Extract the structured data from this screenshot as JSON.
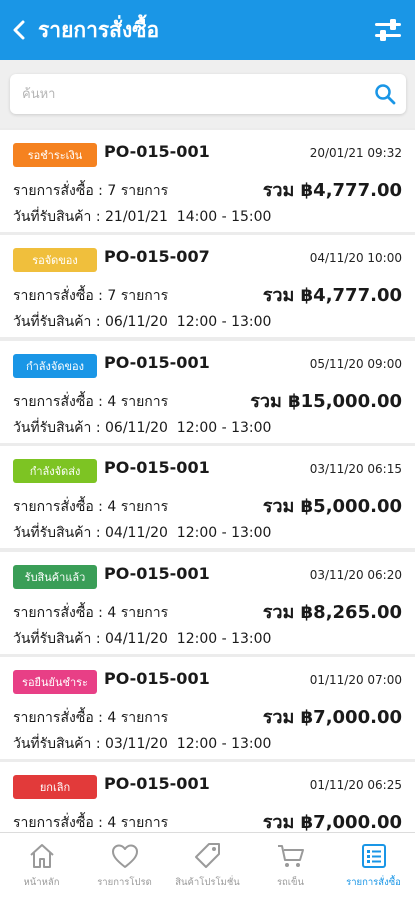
{
  "header": {
    "title": "รายการสั่งซื้อ"
  },
  "search": {
    "placeholder": "ค้นหา"
  },
  "orders": [
    {
      "status": "รอชำระเงิน",
      "color": "#f58220",
      "po": "PO-015-001",
      "date": "20/01/21 09:32",
      "items": "รายการสั่งซื้อ : 7 รายการ",
      "total": "รวม ฿4,777.00",
      "delivery": "วันที่รับสินค้า : 21/01/21  14:00 - 15:00"
    },
    {
      "status": "รอจัดของ",
      "color": "#f0bf3c",
      "po": "PO-015-007",
      "date": "04/11/20 10:00",
      "items": "รายการสั่งซื้อ : 7 รายการ",
      "total": "รวม ฿4,777.00",
      "delivery": "วันที่รับสินค้า : 06/11/20  12:00 - 13:00"
    },
    {
      "status": "กำลังจัดของ",
      "color": "#1a96e6",
      "po": "PO-015-001",
      "date": "05/11/20 09:00",
      "items": "รายการสั่งซื้อ : 4 รายการ",
      "total": "รวม ฿15,000.00",
      "delivery": "วันที่รับสินค้า : 06/11/20  12:00 - 13:00"
    },
    {
      "status": "กำลังจัดส่ง",
      "color": "#7dc423",
      "po": "PO-015-001",
      "date": "03/11/20 06:15",
      "items": "รายการสั่งซื้อ : 4 รายการ",
      "total": "รวม ฿5,000.00",
      "delivery": "วันที่รับสินค้า : 04/11/20  12:00 - 13:00"
    },
    {
      "status": "รับสินค้าแล้ว",
      "color": "#3a9e57",
      "po": "PO-015-001",
      "date": "03/11/20 06:20",
      "items": "รายการสั่งซื้อ : 4 รายการ",
      "total": "รวม ฿8,265.00",
      "delivery": "วันที่รับสินค้า : 04/11/20  12:00 - 13:00"
    },
    {
      "status": "รอยืนยันชำระ",
      "color": "#e83f86",
      "po": "PO-015-001",
      "date": "01/11/20 07:00",
      "items": "รายการสั่งซื้อ : 4 รายการ",
      "total": "รวม ฿7,000.00",
      "delivery": "วันที่รับสินค้า : 03/11/20  12:00 - 13:00"
    },
    {
      "status": "ยกเลิก",
      "color": "#e23a3a",
      "po": "PO-015-001",
      "date": "01/11/20 06:25",
      "items": "รายการสั่งซื้อ : 4 รายการ",
      "total": "รวม ฿7,000.00",
      "delivery": ""
    }
  ],
  "tabbar": {
    "home": "หน้าหลัก",
    "favorites": "รายการโปรด",
    "promotions": "สินค้าโปรโมชั่น",
    "cart": "รถเข็น",
    "orders": "รายการสั่งซื้อ"
  },
  "colors": {
    "primary": "#1a96e6",
    "inactive": "#9a9a9a"
  }
}
